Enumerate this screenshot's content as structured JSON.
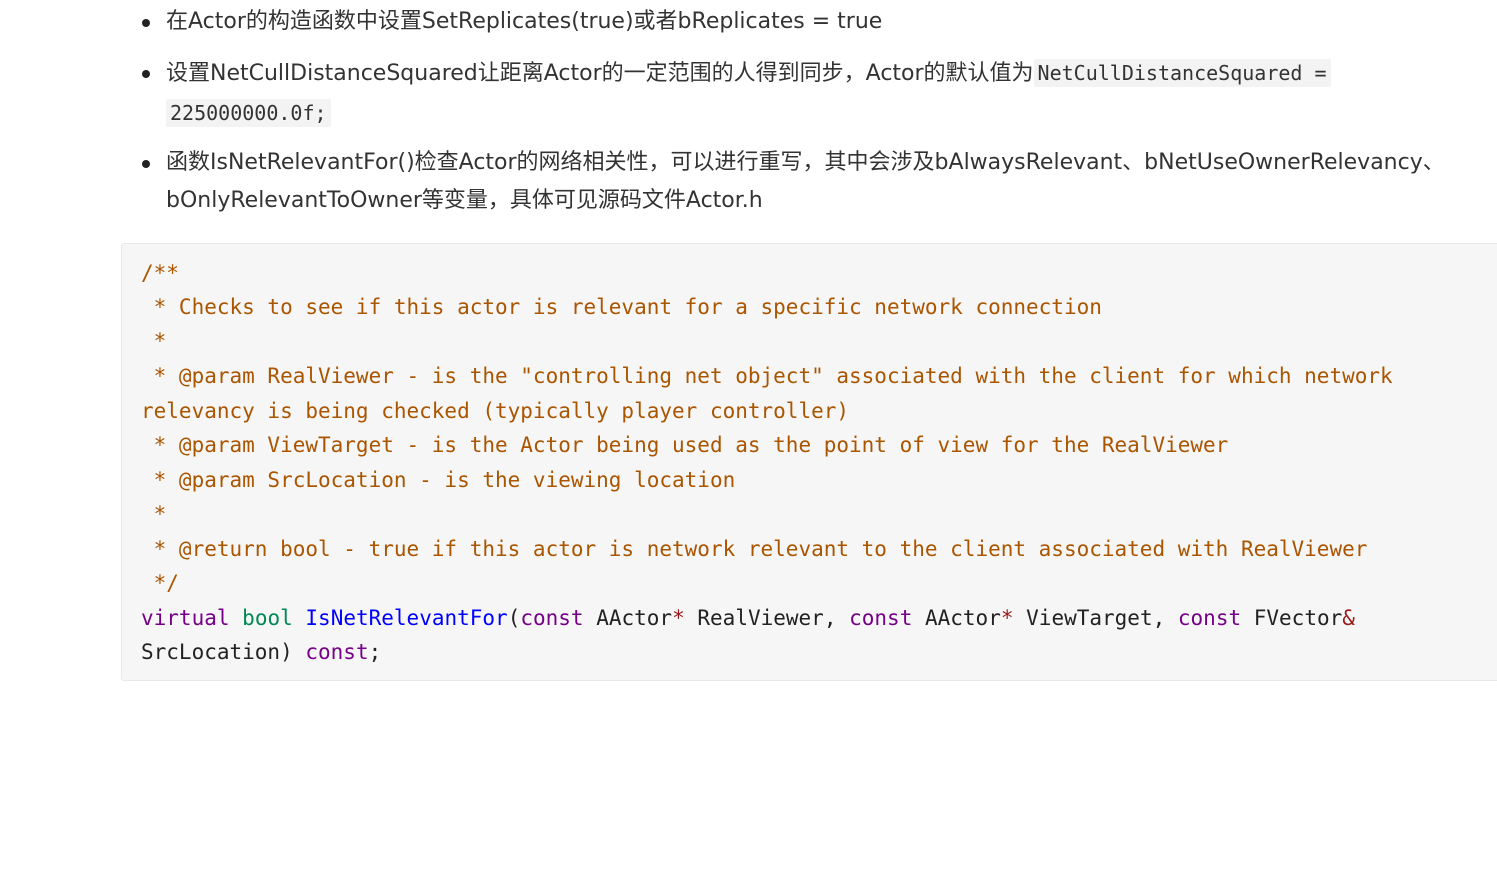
{
  "bullets": [
    {
      "text": "在Actor的构造函数中设置SetReplicates(true)或者bReplicates = true"
    },
    {
      "text": "设置NetCullDistanceSquared让距离Actor的一定范围的人得到同步，Actor的默认值为",
      "code_part1": "NetCullDistanceSquared = ",
      "code_part2": "225000000.0f;"
    },
    {
      "text_line1": "函数IsNetRelevantFor()检查Actor的网络相关性，可以进行重写，其中会涉及bAlwaysRelevant、bNetUseOwnerRelevancy、",
      "text_line2": "bOnlyRelevantToOwner等变量，具体可见源码文件Actor.h"
    }
  ],
  "code": {
    "comment_lines": [
      "/**",
      " * Checks to see if this actor is relevant for a specific network connection",
      " *",
      " * @param RealViewer - is the \"controlling net object\" associated with the client for which network",
      "relevancy is being checked (typically player controller)",
      " * @param ViewTarget - is the Actor being used as the point of view for the RealViewer",
      " * @param SrcLocation - is the viewing location",
      " *",
      " * @return bool - true if this actor is network relevant to the client associated with RealViewer",
      " */"
    ],
    "decl_line1": {
      "kw_virtual": "virtual",
      "type_bool": "bool",
      "fn_name": "IsNetRelevantFor",
      "open_paren": "(",
      "kw_const1": "const",
      "type_aactor1": " AActor",
      "star1": "*",
      "param1": " RealViewer, ",
      "kw_const2": "const",
      "type_aactor2": " AActor",
      "star2": "*",
      "param2": " ViewTarget, ",
      "kw_const3": "const",
      "type_fvector": " FVector",
      "amp": "&"
    },
    "decl_line2": {
      "param3": "SrcLocation) ",
      "kw_const4": "const",
      "semicolon": ";"
    }
  }
}
